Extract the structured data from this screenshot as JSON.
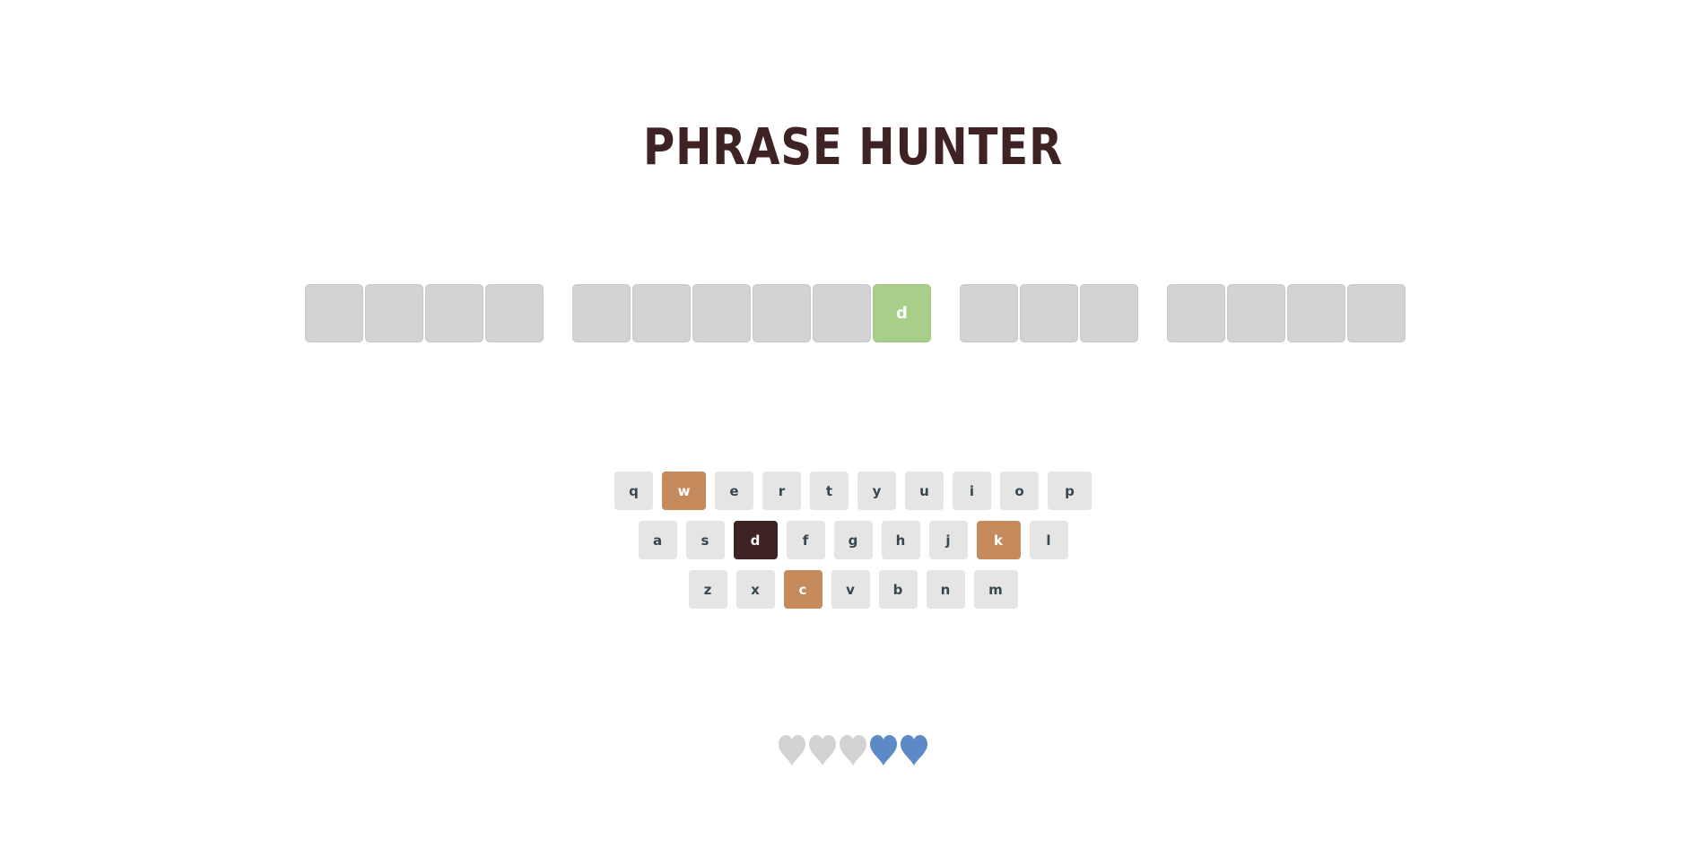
{
  "title": "PHRASE HUNTER",
  "colors": {
    "title": "#3e2224",
    "tile_hidden": "#d3d3d3",
    "tile_revealed": "#a8cf8a",
    "key_default": "#e5e5e5",
    "key_wrong": "#c68b5d",
    "key_chosen": "#3e2224",
    "heart_lost": "#d3d3d3",
    "heart_remaining": "#5b8ac6"
  },
  "phrase": {
    "words": [
      {
        "letters": [
          {
            "char": "",
            "revealed": false
          },
          {
            "char": "",
            "revealed": false
          },
          {
            "char": "",
            "revealed": false
          },
          {
            "char": "",
            "revealed": false
          }
        ]
      },
      {
        "letters": [
          {
            "char": "",
            "revealed": false
          },
          {
            "char": "",
            "revealed": false
          },
          {
            "char": "",
            "revealed": false
          },
          {
            "char": "",
            "revealed": false
          },
          {
            "char": "",
            "revealed": false
          },
          {
            "char": "d",
            "revealed": true
          }
        ]
      },
      {
        "letters": [
          {
            "char": "",
            "revealed": false
          },
          {
            "char": "",
            "revealed": false
          },
          {
            "char": "",
            "revealed": false
          }
        ]
      },
      {
        "letters": [
          {
            "char": "",
            "revealed": false
          },
          {
            "char": "",
            "revealed": false
          },
          {
            "char": "",
            "revealed": false
          },
          {
            "char": "",
            "revealed": false
          }
        ]
      }
    ]
  },
  "keyboard": {
    "rows": [
      [
        {
          "key": "q",
          "state": "default"
        },
        {
          "key": "w",
          "state": "wrong"
        },
        {
          "key": "e",
          "state": "default"
        },
        {
          "key": "r",
          "state": "default"
        },
        {
          "key": "t",
          "state": "default"
        },
        {
          "key": "y",
          "state": "default"
        },
        {
          "key": "u",
          "state": "default"
        },
        {
          "key": "i",
          "state": "default"
        },
        {
          "key": "o",
          "state": "default"
        },
        {
          "key": "p",
          "state": "default"
        }
      ],
      [
        {
          "key": "a",
          "state": "default"
        },
        {
          "key": "s",
          "state": "default"
        },
        {
          "key": "d",
          "state": "chosen"
        },
        {
          "key": "f",
          "state": "default"
        },
        {
          "key": "g",
          "state": "default"
        },
        {
          "key": "h",
          "state": "default"
        },
        {
          "key": "j",
          "state": "default"
        },
        {
          "key": "k",
          "state": "wrong"
        },
        {
          "key": "l",
          "state": "default"
        }
      ],
      [
        {
          "key": "z",
          "state": "default"
        },
        {
          "key": "x",
          "state": "default"
        },
        {
          "key": "c",
          "state": "wrong"
        },
        {
          "key": "v",
          "state": "default"
        },
        {
          "key": "b",
          "state": "default"
        },
        {
          "key": "n",
          "state": "default"
        },
        {
          "key": "m",
          "state": "default"
        }
      ]
    ]
  },
  "lives": {
    "total": 5,
    "remaining": 2,
    "hearts": [
      "lost",
      "lost",
      "lost",
      "remaining",
      "remaining"
    ],
    "icon": "heart-icon"
  }
}
